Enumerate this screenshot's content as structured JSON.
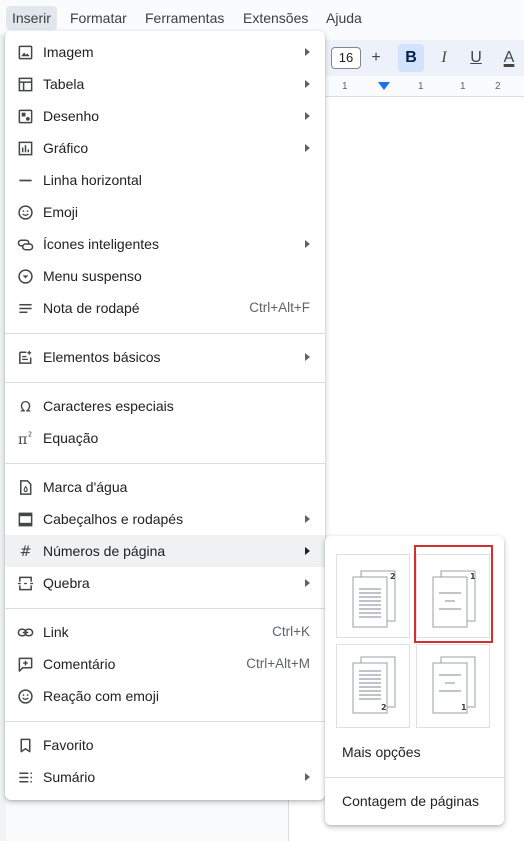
{
  "menubar": {
    "items": [
      "Inserir",
      "Formatar",
      "Ferramentas",
      "Extensões",
      "Ajuda"
    ]
  },
  "toolbar": {
    "font_size": "16",
    "plus": "+",
    "bold": "B",
    "italic": "I",
    "underline": "U",
    "text_color": "A"
  },
  "ruler": {
    "labels": [
      "1",
      "1",
      "1",
      "2"
    ]
  },
  "menu": {
    "items": [
      {
        "label": "Imagem",
        "icon": "image-icon",
        "submenu": true
      },
      {
        "label": "Tabela",
        "icon": "table-icon",
        "submenu": true
      },
      {
        "label": "Desenho",
        "icon": "drawing-icon",
        "submenu": true
      },
      {
        "label": "Gráfico",
        "icon": "chart-icon",
        "submenu": true
      },
      {
        "label": "Linha horizontal",
        "icon": "horizontal-line-icon"
      },
      {
        "label": "Emoji",
        "icon": "emoji-icon"
      },
      {
        "label": "Ícones inteligentes",
        "icon": "smart-chip-icon",
        "submenu": true
      },
      {
        "label": "Menu suspenso",
        "icon": "dropdown-icon"
      },
      {
        "label": "Nota de rodapé",
        "icon": "footnote-icon",
        "shortcut": "Ctrl+Alt+F"
      },
      {
        "label": "Elementos básicos",
        "icon": "building-blocks-icon",
        "submenu": true
      },
      {
        "label": "Caracteres especiais",
        "icon": "omega-icon"
      },
      {
        "label": "Equação",
        "icon": "pi-icon"
      },
      {
        "label": "Marca d'água",
        "icon": "watermark-icon"
      },
      {
        "label": "Cabeçalhos e rodapés",
        "icon": "header-footer-icon",
        "submenu": true
      },
      {
        "label": "Números de página",
        "icon": "hash-icon",
        "submenu": true
      },
      {
        "label": "Quebra",
        "icon": "break-icon",
        "submenu": true
      },
      {
        "label": "Link",
        "icon": "link-icon",
        "shortcut": "Ctrl+K"
      },
      {
        "label": "Comentário",
        "icon": "comment-icon",
        "shortcut": "Ctrl+Alt+M"
      },
      {
        "label": "Reação com emoji",
        "icon": "emoji-reaction-icon"
      },
      {
        "label": "Favorito",
        "icon": "bookmark-icon"
      },
      {
        "label": "Sumário",
        "icon": "toc-icon",
        "submenu": true
      }
    ]
  },
  "submenu": {
    "more_options": "Mais opções",
    "page_count": "Contagem de páginas",
    "options": [
      {
        "name": "top-right-all-pages",
        "number": "2"
      },
      {
        "name": "top-right-skip-first",
        "number": "1"
      },
      {
        "name": "bottom-right-all-pages",
        "number": "2"
      },
      {
        "name": "bottom-right-skip-first",
        "number": "1"
      }
    ]
  }
}
